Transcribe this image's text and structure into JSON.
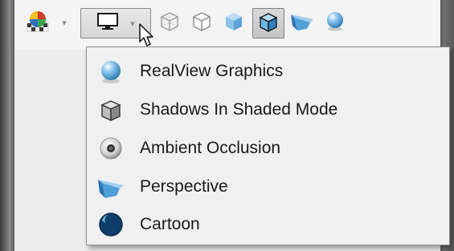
{
  "toolbar": {
    "icons": [
      "appearance-scene-icon",
      "display-style-icon",
      "hidden-lines-visible-icon",
      "hidden-lines-removed-icon",
      "shaded-icon",
      "shaded-with-edges-icon",
      "perspective-icon",
      "realview-sphere-icon"
    ]
  },
  "menu": {
    "items": [
      {
        "label": "RealView Graphics",
        "icon": "realview-sphere-icon"
      },
      {
        "label": "Shadows In Shaded Mode",
        "icon": "shadow-cube-icon"
      },
      {
        "label": "Ambient Occlusion",
        "icon": "ambient-occlusion-icon"
      },
      {
        "label": "Perspective",
        "icon": "perspective-icon"
      },
      {
        "label": "Cartoon",
        "icon": "cartoon-sphere-icon"
      }
    ]
  },
  "colors": {
    "menu_bg": "#f0f0f0",
    "icon_blue": "#1d6fa8"
  }
}
